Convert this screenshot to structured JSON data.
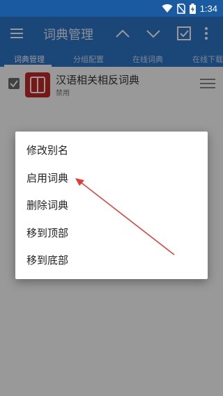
{
  "status_bar": {
    "time": "1:34",
    "icons": [
      "wifi-icon",
      "sim-off-icon",
      "battery-charging-icon"
    ]
  },
  "toolbar": {
    "title": "词典管理",
    "icons": [
      "menu-icon",
      "chevron-up-icon",
      "chevron-down-icon",
      "select-all-icon",
      "more-vert-icon"
    ]
  },
  "tabs": [
    {
      "label": "词典管理"
    },
    {
      "label": "分组配置"
    },
    {
      "label": "在线词典"
    },
    {
      "label": "在线下载"
    }
  ],
  "dictionary_list": {
    "items": [
      {
        "name": "汉语相关相反词典",
        "status": "禁用"
      }
    ]
  },
  "context_menu": {
    "items": [
      {
        "label": "修改别名"
      },
      {
        "label": "启用词典"
      },
      {
        "label": "删除词典"
      },
      {
        "label": "移到顶部"
      },
      {
        "label": "移到底部"
      }
    ]
  },
  "colors": {
    "status_bar": "#1a5aa0",
    "primary": "#2e77c8",
    "dict_icon": "#c62828",
    "annotation_arrow": "#e53935"
  }
}
